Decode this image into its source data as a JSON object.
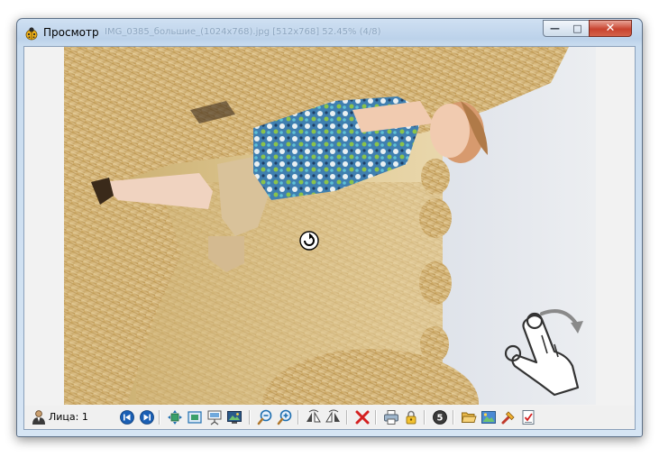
{
  "window": {
    "title": "Просмотр",
    "subtitle": "IMG_0385_большие_(1024x768).jpg    [512x768] 52.45%    (4/8)"
  },
  "icons": {
    "app": "ladybug-icon",
    "minimize": "minimize-icon",
    "maximize": "maximize-icon",
    "close": "close-icon",
    "rotate_cursor": "rotate-cursor-icon",
    "gesture": "touch-rotate-gesture-icon"
  },
  "controls": {
    "minimize_glyph": "—",
    "maximize_glyph": "□",
    "close_glyph": "✕"
  },
  "toolbar": {
    "faces_label": "Лица: 1",
    "page_number": "5",
    "items": [
      {
        "name": "person-icon"
      },
      {
        "name": "previous-icon"
      },
      {
        "name": "next-icon"
      },
      {
        "name": "fit-to-window-icon"
      },
      {
        "name": "actual-size-icon"
      },
      {
        "name": "slideshow-icon"
      },
      {
        "name": "desktop-wallpaper-icon"
      },
      {
        "name": "zoom-out-icon"
      },
      {
        "name": "zoom-in-icon"
      },
      {
        "name": "rotate-left-icon"
      },
      {
        "name": "rotate-right-icon"
      },
      {
        "name": "delete-icon"
      },
      {
        "name": "print-icon"
      },
      {
        "name": "lock-icon"
      },
      {
        "name": "number-badge-icon"
      },
      {
        "name": "open-folder-icon"
      },
      {
        "name": "image-editor-icon"
      },
      {
        "name": "tools-icon"
      },
      {
        "name": "checklist-icon"
      }
    ]
  },
  "colors": {
    "delete_red": "#d42020",
    "nav_blue": "#1a5fb4",
    "frame_blue": "#bcd2ea"
  }
}
